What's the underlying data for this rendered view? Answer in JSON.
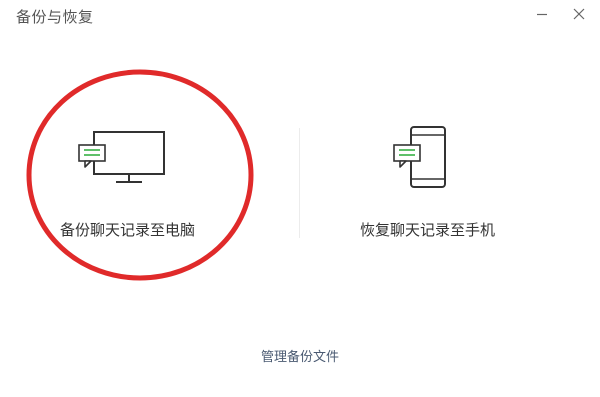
{
  "window": {
    "title": "备份与恢复"
  },
  "window_controls": {
    "minimize_icon": "minimize-icon",
    "close_icon": "close-icon"
  },
  "options": {
    "backup_to_pc": {
      "label": "备份聊天记录至电脑",
      "icon": "monitor-chat-icon"
    },
    "restore_to_phone": {
      "label": "恢复聊天记录至手机",
      "icon": "phone-chat-icon"
    }
  },
  "footer": {
    "manage_backup_label": "管理备份文件"
  },
  "colors": {
    "accent_green": "#5fc06a",
    "highlight_red": "#e02a2a",
    "text": "#333333",
    "link": "#4a5a72"
  }
}
